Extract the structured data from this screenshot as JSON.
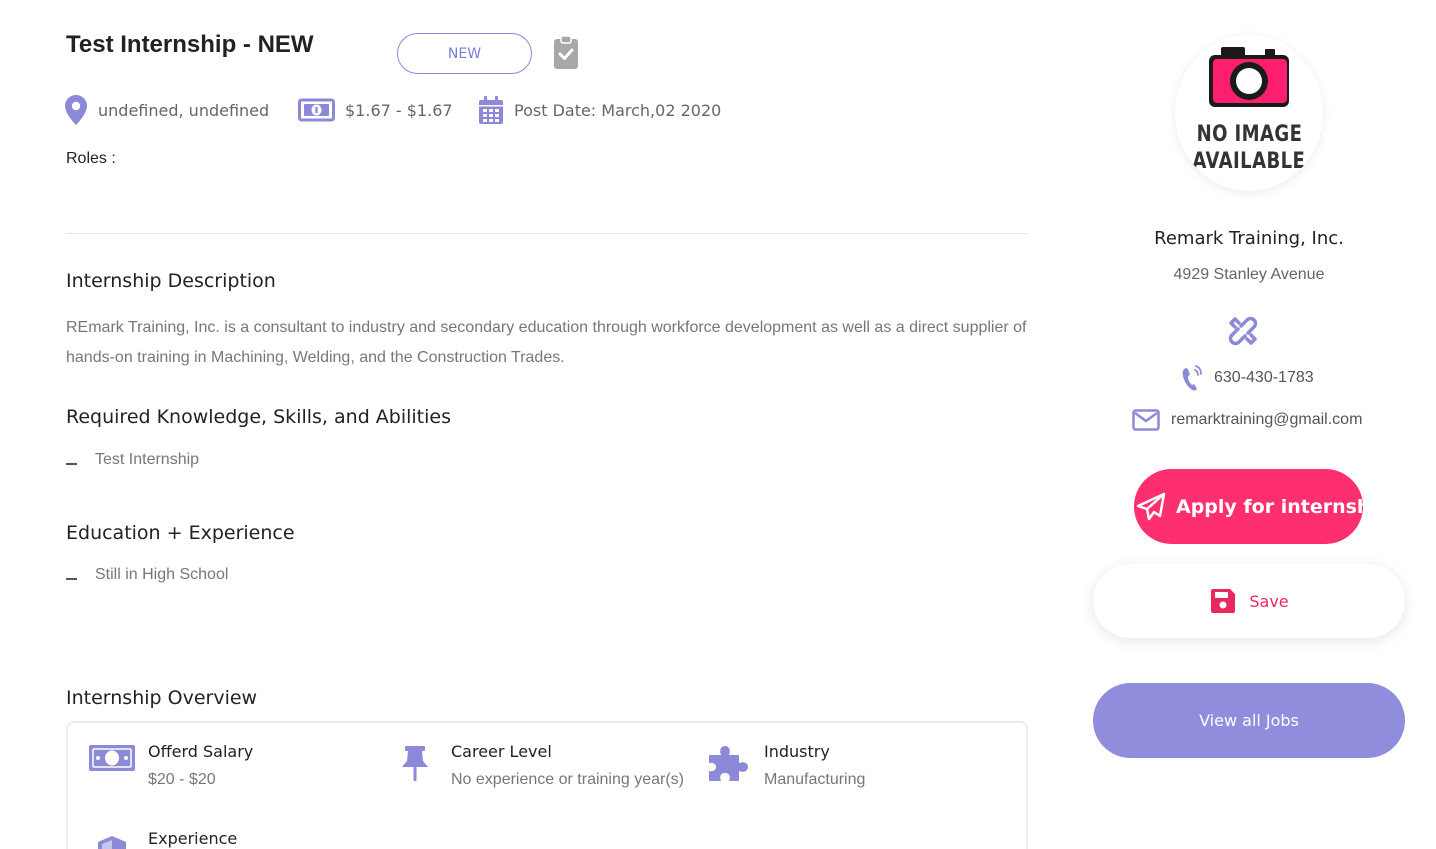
{
  "job": {
    "title": "Test Internship - NEW",
    "badge": "NEW",
    "location": "undefined, undefined",
    "pay": "$1.67 - $1.67",
    "post_date": "Post Date: March,02 2020",
    "roles_label": "Roles :"
  },
  "sections": {
    "description_title": "Internship Description",
    "description_text": "REmark Training, Inc. is a consultant to industry and secondary education through workforce development as well as a direct supplier of hands-on training in Machining, Welding, and the Construction Trades.",
    "ksa_title": "Required Knowledge, Skills, and Abilities",
    "ksa_items": [
      "Test Internship"
    ],
    "education_title": "Education + Experience",
    "education_items": [
      "Still in High School"
    ],
    "overview_title": "Internship Overview"
  },
  "overview": {
    "salary_label": "Offerd Salary",
    "salary_value": "$20 - $20",
    "career_label": "Career Level",
    "career_value": "No experience or training year(s)",
    "industry_label": "Industry",
    "industry_value": "Manufacturing",
    "experience_label": "Experience"
  },
  "company": {
    "logo_line1": "NO IMAGE",
    "logo_line2": "AVAILABLE",
    "name": "Remark Training, Inc.",
    "address": "4929 Stanley Avenue",
    "phone": "630-430-1783",
    "email": "remarktraining@gmail.com"
  },
  "actions": {
    "apply_label": "Apply for internship",
    "save_label": "Save",
    "view_all_label": "View all Jobs"
  },
  "colors": {
    "accent": "#8c8ad8",
    "apply": "#fd2f6f",
    "save_icon": "#e8285e",
    "view_all": "#8f8ddc"
  },
  "icons": [
    "map-pin-icon",
    "money-icon",
    "calendar-icon",
    "clipboard-check-icon",
    "link-icon",
    "phone-icon",
    "envelope-icon",
    "paper-plane-icon",
    "floppy-disk-icon",
    "push-pin-icon",
    "puzzle-icon",
    "shield-icon",
    "camera-icon"
  ]
}
